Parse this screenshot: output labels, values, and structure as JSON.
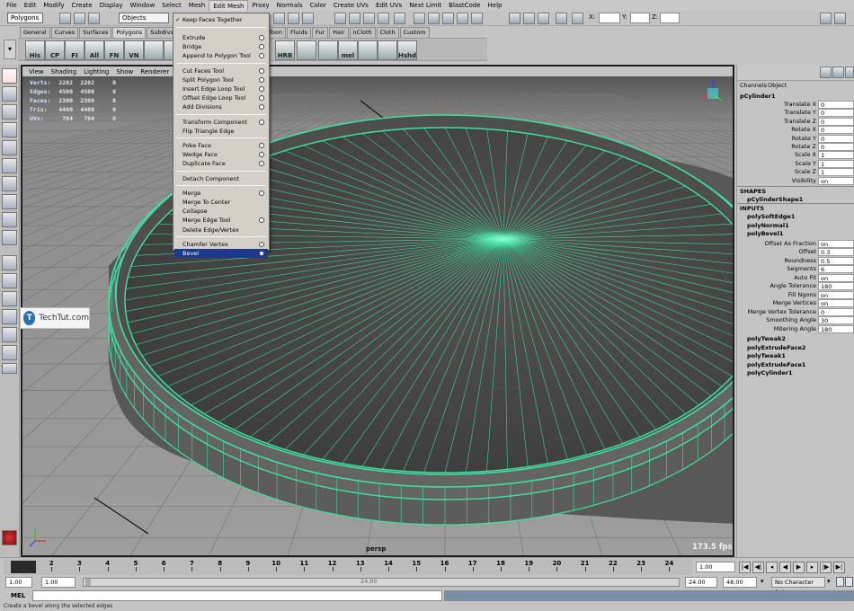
{
  "menubar": [
    "File",
    "Edit",
    "Modify",
    "Create",
    "Display",
    "Window",
    "Select",
    "Mesh",
    "Edit Mesh",
    "Proxy",
    "Normals",
    "Color",
    "Create UVs",
    "Edit UVs",
    "Next Limit",
    "BlastCode",
    "Help"
  ],
  "status": {
    "mode": "Polygons",
    "selection_field": "Objects",
    "x_label": "X:",
    "y_label": "Y:",
    "z_label": "Z:"
  },
  "shelf_tabs": [
    "General",
    "Curves",
    "Surfaces",
    "Polygons",
    "Subdivs",
    "Defo",
    "ering",
    "PaintEffects",
    "Toon",
    "Fluids",
    "Fur",
    "Hair",
    "nCloth",
    "Cloth",
    "Custom"
  ],
  "shelf_icons": [
    "His",
    "CP",
    "FI",
    "All",
    "FN",
    "VN",
    "",
    "",
    "HRB",
    "",
    "",
    "mel",
    "",
    "",
    "Hshd"
  ],
  "viewport": {
    "menu": [
      "View",
      "Shading",
      "Lighting",
      "Show",
      "Renderer",
      "Panels"
    ],
    "hud": [
      {
        "label": "Verts:",
        "a": "2202",
        "b": "2202",
        "c": "0"
      },
      {
        "label": "Edges:",
        "a": "4500",
        "b": "4500",
        "c": "0"
      },
      {
        "label": "Faces:",
        "a": "2300",
        "b": "2300",
        "c": "0"
      },
      {
        "label": "Tris:",
        "a": "4400",
        "b": "4400",
        "c": "0"
      },
      {
        "label": "UVs:",
        "a": "784",
        "b": "784",
        "c": "0"
      }
    ],
    "camera": "persp",
    "fps": "173.5 fps"
  },
  "dropdown": {
    "tearoff": "Keep Faces Together",
    "items": [
      {
        "label": "Extrude",
        "opt": true
      },
      {
        "label": "Bridge",
        "opt": true
      },
      {
        "label": "Append to Polygon Tool",
        "opt": true
      },
      {
        "sep": true
      },
      {
        "label": "Cut Faces Tool",
        "opt": true
      },
      {
        "label": "Split Polygon Tool",
        "opt": true
      },
      {
        "label": "Insert Edge Loop Tool",
        "opt": true
      },
      {
        "label": "Offset Edge Loop Tool",
        "opt": true
      },
      {
        "label": "Add Divisions",
        "opt": true
      },
      {
        "sep": true
      },
      {
        "label": "Transform Component",
        "opt": true
      },
      {
        "label": "Flip Triangle Edge",
        "opt": false
      },
      {
        "sep": true
      },
      {
        "label": "Poke Face",
        "opt": true
      },
      {
        "label": "Wedge Face",
        "opt": true
      },
      {
        "label": "Duplicate Face",
        "opt": true
      },
      {
        "sep": true
      },
      {
        "label": "Detach Component",
        "opt": false
      },
      {
        "sep": true
      },
      {
        "label": "Merge",
        "opt": true
      },
      {
        "label": "Merge To Center",
        "opt": false
      },
      {
        "label": "Collapse",
        "opt": false
      },
      {
        "label": "Merge Edge Tool",
        "opt": true
      },
      {
        "label": "Delete Edge/Vertex",
        "opt": false
      },
      {
        "sep": true
      },
      {
        "label": "Chamfer Vertex",
        "opt": true
      },
      {
        "label": "Bevel",
        "opt": true,
        "highlight": true
      }
    ]
  },
  "channelbox": {
    "tabs": [
      "Channels",
      "Object"
    ],
    "object": "pCylinder1",
    "attrs": [
      {
        "label": "Translate X",
        "value": "0"
      },
      {
        "label": "Translate Y",
        "value": "0"
      },
      {
        "label": "Translate Z",
        "value": "0"
      },
      {
        "label": "Rotate X",
        "value": "0"
      },
      {
        "label": "Rotate Y",
        "value": "0"
      },
      {
        "label": "Rotate Z",
        "value": "0"
      },
      {
        "label": "Scale X",
        "value": "1"
      },
      {
        "label": "Scale Y",
        "value": "1"
      },
      {
        "label": "Scale Z",
        "value": "1"
      },
      {
        "label": "Visibility",
        "value": "on"
      }
    ],
    "shapes_header": "SHAPES",
    "shape": "pCylinderShape1",
    "inputs_header": "INPUTS",
    "inputs_top": [
      "polySoftEdge1",
      "polyNormal1",
      "polyBevel1"
    ],
    "bevel_attrs": [
      {
        "label": "Offset As Fraction",
        "value": "on"
      },
      {
        "label": "Offset",
        "value": "0.3"
      },
      {
        "label": "Roundness",
        "value": "0.5"
      },
      {
        "label": "Segments",
        "value": "6"
      },
      {
        "label": "Auto Fit",
        "value": "on"
      },
      {
        "label": "Angle Tolerance",
        "value": "180"
      },
      {
        "label": "Fill Ngons",
        "value": "on"
      },
      {
        "label": "Merge Vertices",
        "value": "on"
      },
      {
        "label": "Merge Vertex Tolerance",
        "value": "0"
      },
      {
        "label": "Smoothing Angle",
        "value": "30"
      },
      {
        "label": "Mitering Angle",
        "value": "180"
      }
    ],
    "inputs_bottom": [
      "polyTweak2",
      "polyExtrudeFace2",
      "polyTweak1",
      "polyExtrudeFace1",
      "polyCylinder1"
    ]
  },
  "watermark": {
    "logo": "T",
    "text": "TechTut.com"
  },
  "timeline": {
    "ticks": [
      "1",
      "2",
      "3",
      "4",
      "5",
      "6",
      "7",
      "8",
      "9",
      "10",
      "11",
      "12",
      "13",
      "14",
      "15",
      "16",
      "17",
      "18",
      "19",
      "20",
      "21",
      "22",
      "23",
      "24"
    ],
    "current_frame": "1.00"
  },
  "range": {
    "start": "1.00",
    "start2": "1.00",
    "range_label": "24.00",
    "end": "24.00",
    "end2": "48.00",
    "character_set": "No Character Set"
  },
  "command": {
    "label": "MEL"
  },
  "help_text": "Create a bevel along the selected edges",
  "colors": {
    "wire": "#3ee0a0",
    "highlight": "#1c3890",
    "viewport_bg": "#9a9a9a"
  }
}
